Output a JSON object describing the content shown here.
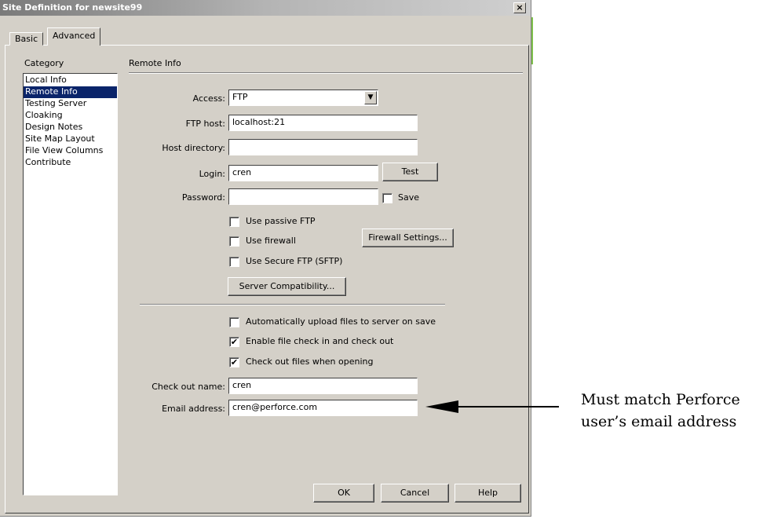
{
  "window": {
    "title": "Site Definition for newsite99",
    "close_glyph": "×"
  },
  "tabs": [
    {
      "label": "Basic"
    },
    {
      "label": "Advanced"
    }
  ],
  "category": {
    "header": "Category",
    "items": [
      "Local Info",
      "Remote Info",
      "Testing Server",
      "Cloaking",
      "Design Notes",
      "Site Map Layout",
      "File View Columns",
      "Contribute"
    ],
    "selected": "Remote Info"
  },
  "section_title": "Remote Info",
  "form": {
    "access_label": "Access:",
    "access_value": "FTP",
    "ftp_host_label": "FTP host:",
    "ftp_host_value": "localhost:21",
    "host_dir_label": "Host directory:",
    "host_dir_value": "",
    "login_label": "Login:",
    "login_value": "cren",
    "password_label": "Password:",
    "password_value": "",
    "test_button": "Test",
    "save_label": "Save",
    "save_checked": false,
    "passive_label": "Use passive FTP",
    "passive_checked": false,
    "firewall_label": "Use firewall",
    "firewall_checked": false,
    "firewall_settings_button": "Firewall Settings...",
    "sftp_label": "Use Secure FTP (SFTP)",
    "sftp_checked": false,
    "server_compat_button": "Server Compatibility...",
    "auto_upload_label": "Automatically upload files to server on save",
    "auto_upload_checked": false,
    "checkin_label": "Enable file check in and check out",
    "checkin_checked": true,
    "checkout_open_label": "Check out files when opening",
    "checkout_open_checked": true,
    "checkout_name_label": "Check out name:",
    "checkout_name_value": "cren",
    "email_label": "Email address:",
    "email_value": "cren@perforce.com"
  },
  "buttons": {
    "ok": "OK",
    "cancel": "Cancel",
    "help": "Help"
  },
  "annotation": {
    "line1": "Must match Perforce",
    "line2": "user’s email address"
  },
  "colors": {
    "dialog_bg": "#d4d0c8",
    "selection": "#0a246a"
  }
}
